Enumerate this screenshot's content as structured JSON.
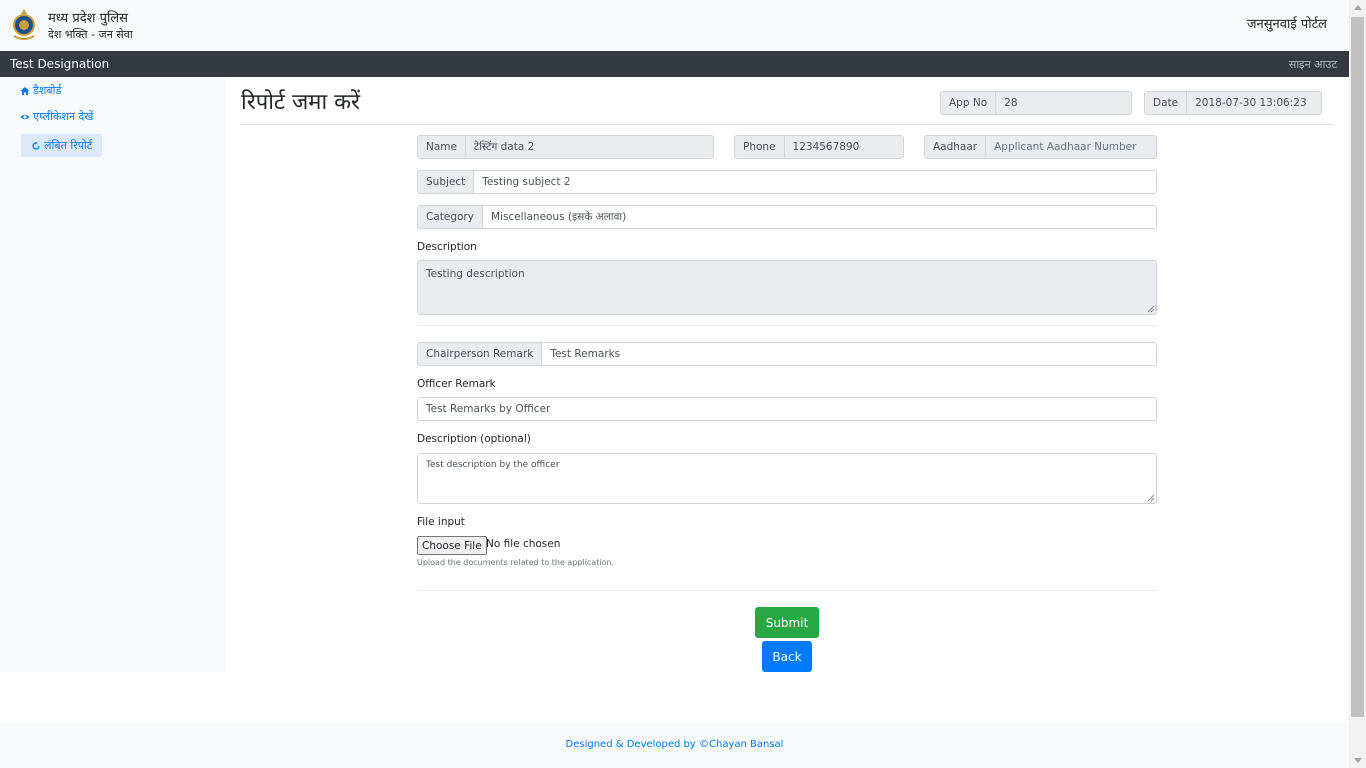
{
  "header": {
    "brand_title": "मध्य प्रदेश पुलिस",
    "brand_subtitle": "देश भक्ति - जन सेवा",
    "portal_title": "जनसुनवाई पोर्टल"
  },
  "navbar": {
    "brand": "Test Designation",
    "signout": "साइन आउट"
  },
  "sidebar": {
    "items": [
      {
        "label": "डैशबोर्ड",
        "icon": "home-icon"
      },
      {
        "label": "एप्लीकेशन देखें",
        "icon": "eye-icon"
      },
      {
        "label": "लंबित रिपोर्ट",
        "icon": "refresh-icon",
        "active": true
      }
    ]
  },
  "page": {
    "title": "रिपोर्ट जमा करें",
    "app_no_label": "App No",
    "app_no": "28",
    "date_label": "Date",
    "date": "2018-07-30 13:06:23"
  },
  "form": {
    "name_label": "Name",
    "name": "टेस्टिंग data 2",
    "phone_label": "Phone",
    "phone": "1234567890",
    "aadhaar_label": "Aadhaar",
    "aadhaar_placeholder": "Applicant Aadhaar Number",
    "subject_label": "Subject",
    "subject": "Testing subject 2",
    "category_label": "Category",
    "category": "Miscellaneous (इसके अलावा)",
    "description_label": "Description",
    "description": "Testing description",
    "chairperson_label": "Chairperson Remark",
    "chairperson_remark": "Test Remarks",
    "officer_label": "Officer Remark",
    "officer_remark": "Test Remarks by Officer",
    "desc_optional_label": "Description (optional)",
    "desc_optional": "Test description by the officer",
    "file_label": "File input",
    "file_button": "Choose File",
    "file_status": "No file chosen",
    "file_help": "Upload the documents related to the application.",
    "submit": "Submit",
    "back": "Back"
  },
  "footer": {
    "text": "Designed & Developed by ©Chayan Bansal"
  },
  "colors": {
    "navbar": "#343a40",
    "primary": "#007bff",
    "success": "#28a745"
  }
}
